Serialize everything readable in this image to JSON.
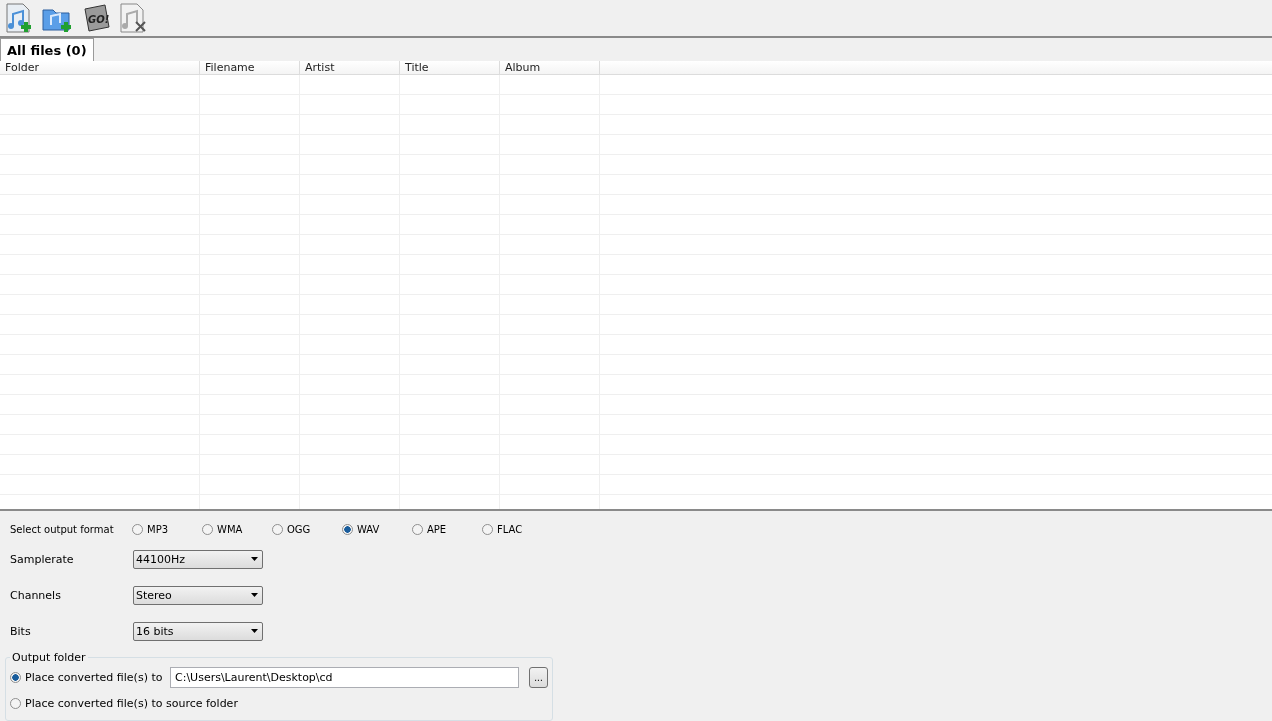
{
  "toolbar": [
    {
      "kind": "add-file"
    },
    {
      "kind": "add-folder"
    },
    {
      "kind": "go",
      "label": "GO!"
    },
    {
      "kind": "remove"
    }
  ],
  "tabs": [
    {
      "label": "All files (0)",
      "selected": true
    }
  ],
  "table": {
    "columns": [
      "Folder",
      "Filename",
      "Artist",
      "Title",
      "Album"
    ]
  },
  "format": {
    "label": "Select output format",
    "options": [
      {
        "label": "MP3",
        "selected": false
      },
      {
        "label": "WMA",
        "selected": false
      },
      {
        "label": "OGG",
        "selected": false
      },
      {
        "label": "WAV",
        "selected": true
      },
      {
        "label": "APE",
        "selected": false
      },
      {
        "label": "FLAC",
        "selected": false
      }
    ]
  },
  "settings": [
    {
      "label": "Samplerate",
      "value": "44100Hz"
    },
    {
      "label": "Channels",
      "value": "Stereo"
    },
    {
      "label": "Bits",
      "value": "16 bits"
    }
  ],
  "output_folder": {
    "title": "Output folder",
    "options": [
      {
        "label": "Place converted file(s) to",
        "selected": true,
        "path": "C:\\Users\\Laurent\\Desktop\\cd",
        "browse": "..."
      },
      {
        "label": "Place converted file(s) to source folder",
        "selected": false
      }
    ]
  }
}
